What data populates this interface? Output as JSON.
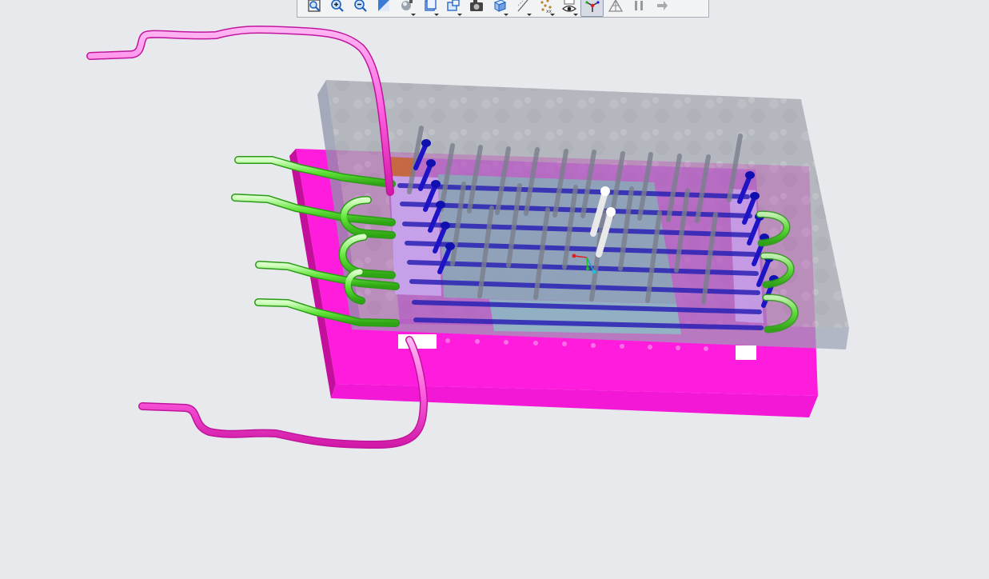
{
  "toolbar": {
    "buttons": [
      {
        "name": "refit-button",
        "icon": "zoom-fit-icon",
        "dropdown": false,
        "active": false
      },
      {
        "name": "zoom-in-button",
        "icon": "zoom-in-icon",
        "dropdown": false,
        "active": false
      },
      {
        "name": "zoom-out-button",
        "icon": "zoom-out-icon",
        "dropdown": false,
        "active": false
      },
      {
        "name": "repaint-button",
        "icon": "repaint-icon",
        "dropdown": false,
        "active": false
      },
      {
        "name": "display-style-button",
        "icon": "display-style-icon",
        "dropdown": true,
        "active": false
      },
      {
        "name": "saved-orientations-button",
        "icon": "saved-views-icon",
        "dropdown": true,
        "active": false
      },
      {
        "name": "view-manager-button",
        "icon": "view-manager-icon",
        "dropdown": true,
        "active": false
      },
      {
        "name": "perspective-button",
        "icon": "camera-icon",
        "dropdown": false,
        "active": false
      },
      {
        "name": "section-button",
        "icon": "section-cube-icon",
        "dropdown": true,
        "active": false
      },
      {
        "name": "sketch-display-button",
        "icon": "sketch-icon",
        "dropdown": true,
        "active": false
      },
      {
        "name": "datum-display-button",
        "icon": "datum-points-icon",
        "dropdown": true,
        "active": false
      },
      {
        "name": "annotation-display-button",
        "icon": "eye-icon",
        "dropdown": true,
        "active": false
      },
      {
        "name": "spin-center-button",
        "icon": "spin-center-icon",
        "dropdown": false,
        "active": true
      },
      {
        "name": "mesh-display-button",
        "icon": "mesh-triangle-icon",
        "dropdown": false,
        "active": false
      },
      {
        "name": "pause-button",
        "icon": "pause-icon",
        "dropdown": false,
        "active": false
      },
      {
        "name": "exit-button",
        "icon": "exit-icon",
        "dropdown": false,
        "active": false
      }
    ]
  },
  "colors": {
    "background": "#e8e9ed",
    "base_plate": "#ff22dd",
    "base_plate_side": "#c9109f",
    "cavity_plate": "#8c98ad",
    "inlet_tube": "#ff6fe3",
    "cooling_line": "#55e63a",
    "ejector_pin": "#1010c8",
    "guide_pin": "#f2f2f2"
  }
}
